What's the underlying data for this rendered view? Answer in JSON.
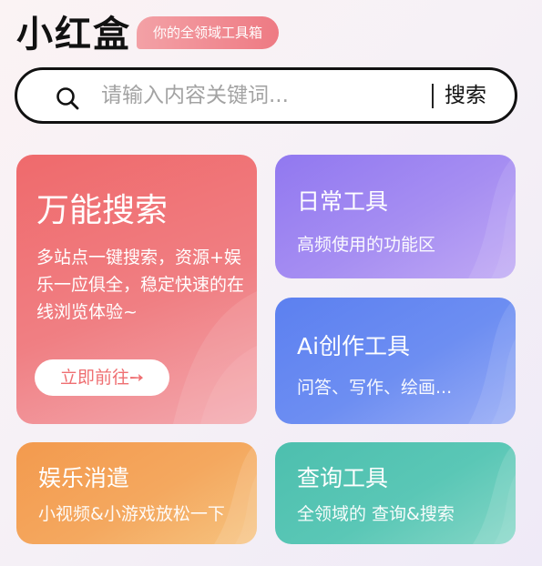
{
  "header": {
    "logo": "小红盒",
    "tagline": "你的全领域工具箱"
  },
  "search": {
    "placeholder": "请输入内容关键词...",
    "button_label": "搜索"
  },
  "cards": {
    "universal_search": {
      "title": "万能搜索",
      "description": "多站点一键搜索，资源+娱乐一应俱全，稳定快速的在线浏览体验~",
      "button_label": "立即前往➙",
      "color": "#ef6a6c"
    },
    "daily_tools": {
      "title": "日常工具",
      "subtitle": "高频使用的功能区",
      "color": "#9178f0"
    },
    "ai_tools": {
      "title": "Ai创作工具",
      "subtitle": "问答、写作、绘画...",
      "color": "#5c80f0"
    },
    "entertainment": {
      "title": "娱乐消遣",
      "subtitle": "小视频&小游戏放松一下",
      "color": "#f39a4e"
    },
    "query_tools": {
      "title": "查询工具",
      "subtitle": "全领域的 查询&搜索",
      "color": "#4dbfae"
    }
  }
}
